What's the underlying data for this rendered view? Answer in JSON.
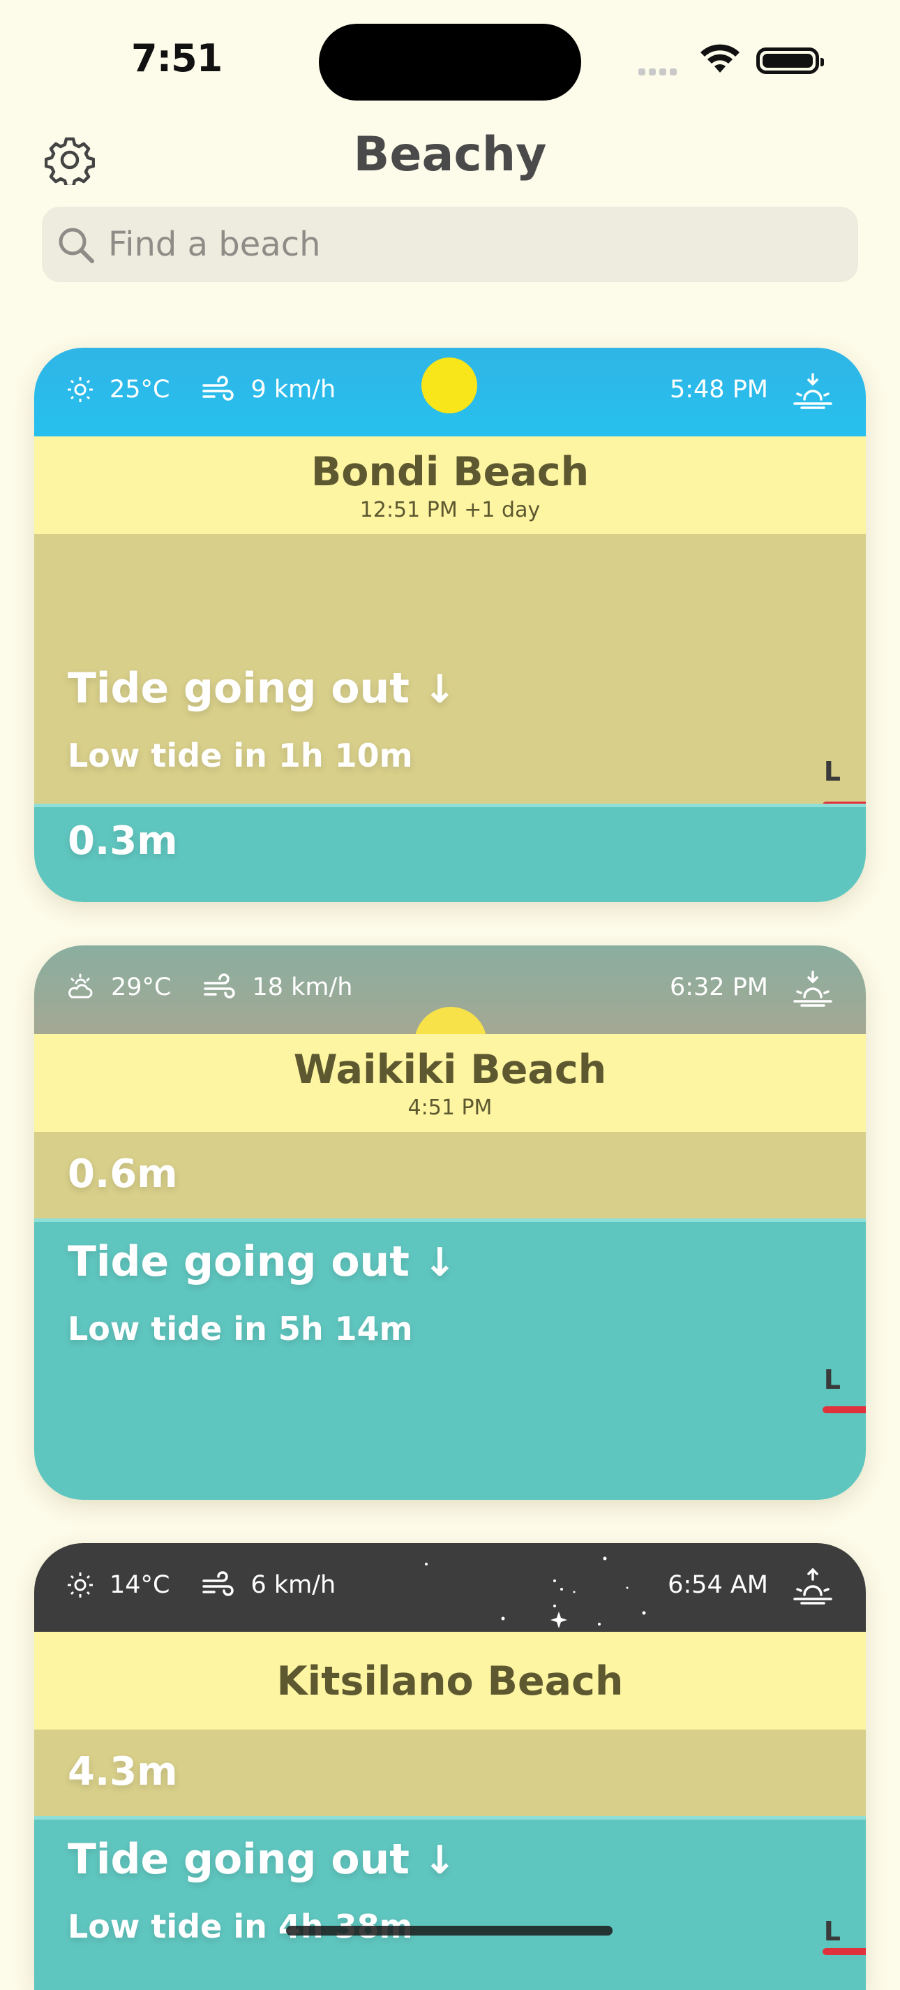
{
  "status": {
    "time": "7:51"
  },
  "header": {
    "title": "Beachy",
    "search_placeholder": "Find a beach"
  },
  "colors": {
    "background": "#fdfbe9",
    "name_bar": "#fdf5a1",
    "sand": "#d8cf8a",
    "water": "#5fc6bf",
    "low_tide_marker": "#e0323c",
    "sun": "#f8e61b"
  },
  "beaches": [
    {
      "name": "Bondi Beach",
      "local_time": "12:51 PM +1 day",
      "temperature": "25°C",
      "weather_icon": "sun-icon",
      "wind": "9 km/h",
      "sunset": "5:48 PM",
      "tide_height": "0.3m",
      "tide_status": "Tide going out",
      "tide_arrow": "↓",
      "tide_next": "Low tide in 1h 10m",
      "marker": "L"
    },
    {
      "name": "Waikiki Beach",
      "local_time": "4:51 PM",
      "temperature": "29°C",
      "weather_icon": "partly-cloudy-icon",
      "wind": "18 km/h",
      "sunset": "6:32 PM",
      "tide_height": "0.6m",
      "tide_status": "Tide going out",
      "tide_arrow": "↓",
      "tide_next": "Low tide in 5h 14m",
      "marker": "L"
    },
    {
      "name": "Kitsilano Beach",
      "local_time": "",
      "temperature": "14°C",
      "weather_icon": "sun-icon",
      "wind": "6 km/h",
      "sunset": "6:54 AM",
      "tide_height": "4.3m",
      "tide_status": "Tide going out",
      "tide_arrow": "↓",
      "tide_next": "Low tide in 4h 38m",
      "marker": "L"
    }
  ]
}
